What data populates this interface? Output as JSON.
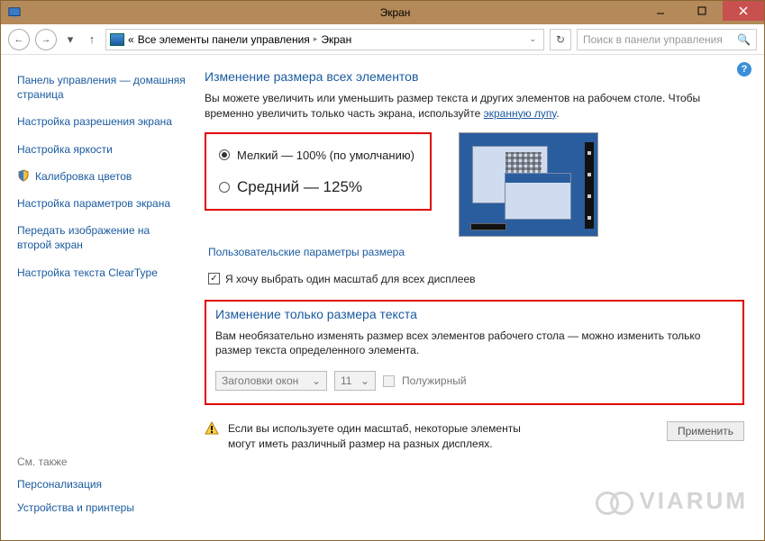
{
  "window": {
    "title": "Экран"
  },
  "nav": {
    "breadcrumb_prefix": "«",
    "breadcrumb1": "Все элементы панели управления",
    "breadcrumb2": "Экран",
    "search_placeholder": "Поиск в панели управления"
  },
  "sidebar": {
    "items": [
      {
        "label": "Панель управления — домашняя страница",
        "shield": false
      },
      {
        "label": "Настройка разрешения экрана",
        "shield": false
      },
      {
        "label": "Настройка яркости",
        "shield": false
      },
      {
        "label": "Калибровка цветов",
        "shield": true
      },
      {
        "label": "Настройка параметров экрана",
        "shield": false
      },
      {
        "label": "Передать изображение на второй экран",
        "shield": false
      },
      {
        "label": "Настройка текста ClearType",
        "shield": false
      }
    ],
    "see_also_title": "См. также",
    "see_also": [
      "Персонализация",
      "Устройства и принтеры"
    ]
  },
  "main": {
    "heading1": "Изменение размера всех элементов",
    "desc1a": "Вы можете увеличить или уменьшить размер текста и других элементов на рабочем столе. Чтобы временно увеличить только часть экрана, используйте ",
    "desc1_link": "экранную лупу",
    "radios": {
      "small": "Мелкий — 100% (по умолчанию)",
      "medium": "Средний — 125%"
    },
    "custom_link": "Пользовательские параметры размера",
    "checkbox1": "Я хочу выбрать один масштаб для всех дисплеев",
    "heading2": "Изменение только размера текста",
    "desc2": "Вам необязательно изменять размер всех элементов рабочего стола — можно изменить только размер текста определенного элемента.",
    "select_element": "Заголовки окон",
    "select_size": "11",
    "bold_label": "Полужирный",
    "warning": "Если вы используете один масштаб, некоторые элементы могут иметь различный размер на разных дисплеях.",
    "apply": "Применить"
  },
  "watermark": "VIARUM"
}
